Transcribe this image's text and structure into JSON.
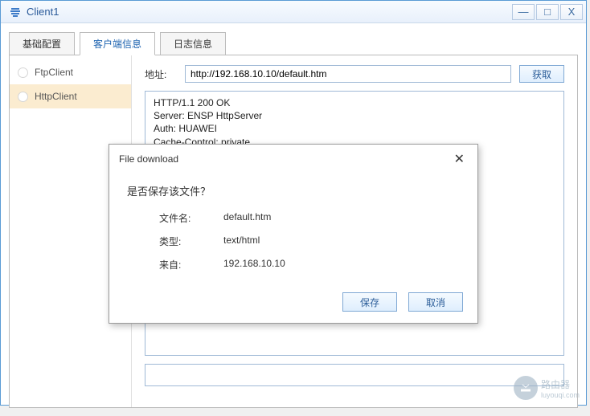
{
  "window": {
    "title": "Client1"
  },
  "tabs": [
    {
      "label": "基础配置"
    },
    {
      "label": "客户端信息"
    },
    {
      "label": "日志信息"
    }
  ],
  "sidebar": {
    "items": [
      {
        "label": "FtpClient"
      },
      {
        "label": "HttpClient"
      }
    ]
  },
  "address": {
    "label": "地址:",
    "value": "http://192.168.10.10/default.htm",
    "fetch_label": "获取"
  },
  "response_text": "HTTP/1.1 200 OK\nServer: ENSP HttpServer\nAuth: HUAWEI\nCache-Control: private\nContent-Type: text/html",
  "dialog": {
    "title": "File download",
    "question": "是否保存该文件？",
    "filename_label": "文件名:",
    "filename_value": "default.htm",
    "type_label": "类型:",
    "type_value": "text/html",
    "from_label": "来自:",
    "from_value": "192.168.10.10",
    "save_label": "保存",
    "cancel_label": "取消"
  },
  "watermark": {
    "brand": "路由器",
    "sub": "luyouqi.com"
  }
}
